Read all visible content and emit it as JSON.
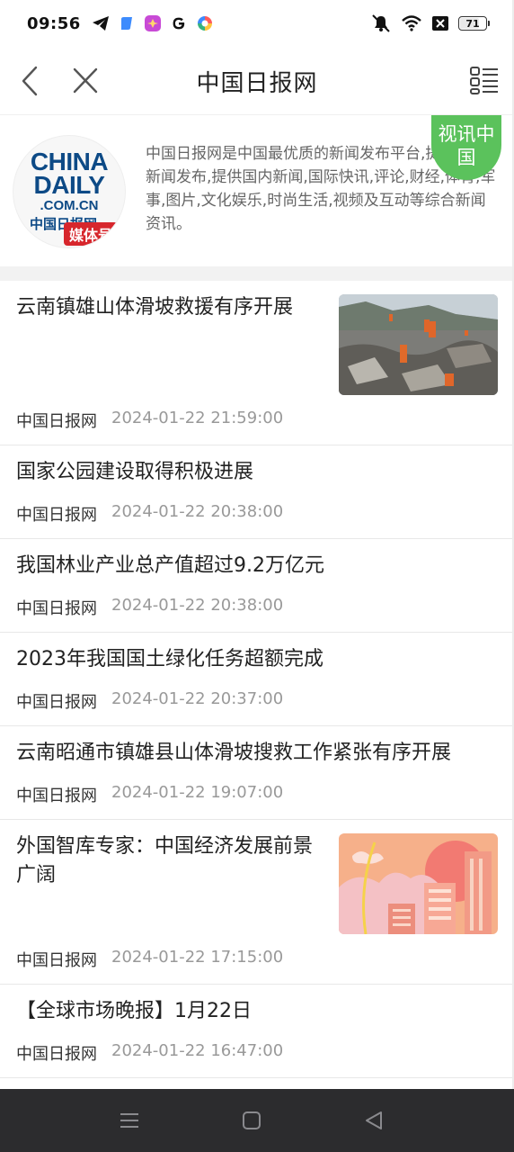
{
  "status_bar": {
    "time": "09:56",
    "left_icons": [
      "telegram-icon",
      "app-icon-blue",
      "app-icon-pink",
      "google-g-icon",
      "app-icon-colorful"
    ],
    "right_icons": [
      "mute-icon",
      "wifi-icon",
      "close-box-icon",
      "battery-icon"
    ],
    "battery": "71"
  },
  "header": {
    "title": "中国日报网",
    "back_icon": "chevron-left-icon",
    "close_icon": "close-icon",
    "menu_icon": "list-menu-icon"
  },
  "profile": {
    "logo": {
      "line1": "CHINA",
      "line2": "DAILY",
      "line3": ".COM.CN",
      "line4": "中国日报网",
      "badge": "媒体号"
    },
    "description": "中国日报网是中国最优质的新闻发布平台,提供实时新闻发布,提供国内新闻,国际快讯,评论,财经,体育,军事,图片,文化娱乐,时尚生活,视频及互动等综合新闻资讯。",
    "corner_badge": "视讯中国",
    "accent_color": "#5bc25c"
  },
  "news": [
    {
      "title": "云南镇雄山体滑坡救援有序开展",
      "source": "中国日报网",
      "time": "2024-01-22 21:59:00",
      "has_image": true
    },
    {
      "title": "国家公园建设取得积极进展",
      "source": "中国日报网",
      "time": "2024-01-22 20:38:00"
    },
    {
      "title": "我国林业产业总产值超过9.2万亿元",
      "source": "中国日报网",
      "time": "2024-01-22 20:38:00"
    },
    {
      "title": "2023年我国国土绿化任务超额完成",
      "source": "中国日报网",
      "time": "2024-01-22 20:37:00"
    },
    {
      "title": "云南昭通市镇雄县山体滑坡搜救工作紧张有序开展",
      "source": "中国日报网",
      "time": "2024-01-22 19:07:00"
    },
    {
      "title": "外国智库专家：中国经济发展前景广阔",
      "source": "中国日报网",
      "time": "2024-01-22 17:15:00",
      "has_image": true
    },
    {
      "title": "【全球市场晚报】1月22日",
      "source": "中国日报网",
      "time": "2024-01-22 16:47:00"
    }
  ],
  "bottom_nav": {
    "icons": [
      "menu-lines-icon",
      "home-square-icon",
      "back-triangle-icon"
    ]
  }
}
